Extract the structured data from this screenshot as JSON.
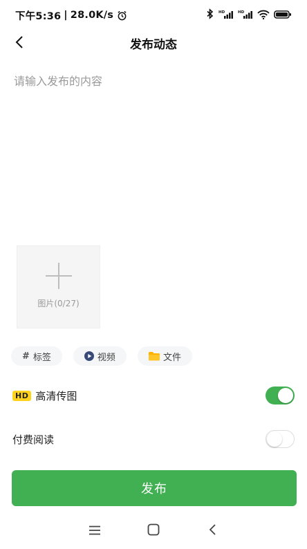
{
  "status_bar": {
    "time": "下午5:36",
    "separator": "|",
    "speed": "28.0K/s",
    "icons": [
      "alarm-icon",
      "bluetooth-icon",
      "signal-hd-icon",
      "signal-hd-icon",
      "wifi-icon",
      "battery-icon"
    ]
  },
  "header": {
    "title": "发布动态",
    "back_icon": "chevron-left-icon"
  },
  "editor": {
    "placeholder": "请输入发布的内容",
    "value": ""
  },
  "image_picker": {
    "label": "图片(0/27)",
    "icon": "plus-icon"
  },
  "chips": [
    {
      "icon": "hash-icon",
      "glyph": "#",
      "label": "标签"
    },
    {
      "icon": "play-circle-icon",
      "label": "视频"
    },
    {
      "icon": "folder-icon",
      "label": "文件"
    }
  ],
  "options": {
    "hd": {
      "badge": "HD",
      "label": "高清传图",
      "enabled": true
    },
    "paid": {
      "label": "付费阅读",
      "enabled": false
    }
  },
  "publish_label": "发布",
  "nav": {
    "icons": [
      "menu-icon",
      "home-square-icon",
      "back-triangle-icon"
    ]
  },
  "colors": {
    "accent": "#41b052",
    "badge": "#ffd21f",
    "folder": "#ffb300",
    "play": "#3a4a78"
  }
}
